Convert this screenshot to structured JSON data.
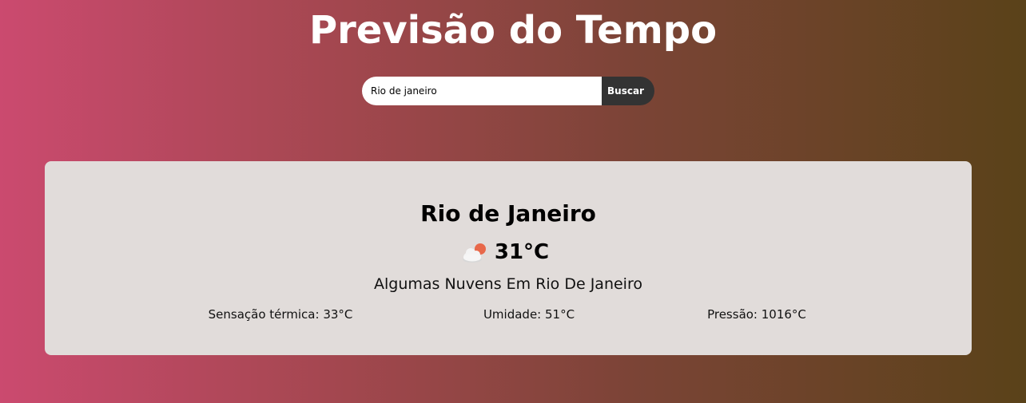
{
  "header": {
    "title": "Previsão do Tempo"
  },
  "search": {
    "value": "Rio de janeiro",
    "button_label": "Buscar"
  },
  "weather": {
    "city": "Rio de Janeiro",
    "icon": "partly-cloudy-sun-icon",
    "temperature": "31°C",
    "description": "Algumas Nuvens Em Rio De Janeiro",
    "details": {
      "feels_like": "Sensação térmica: 33°C",
      "humidity": "Umidade: 51°C",
      "pressure": "Pressão: 1016°C"
    }
  },
  "colors": {
    "gradient_start": "#cb4a6f",
    "gradient_end": "#5a4219",
    "card_background": "#e1dcda",
    "button_background": "#333333",
    "sun": "#e8684a"
  }
}
